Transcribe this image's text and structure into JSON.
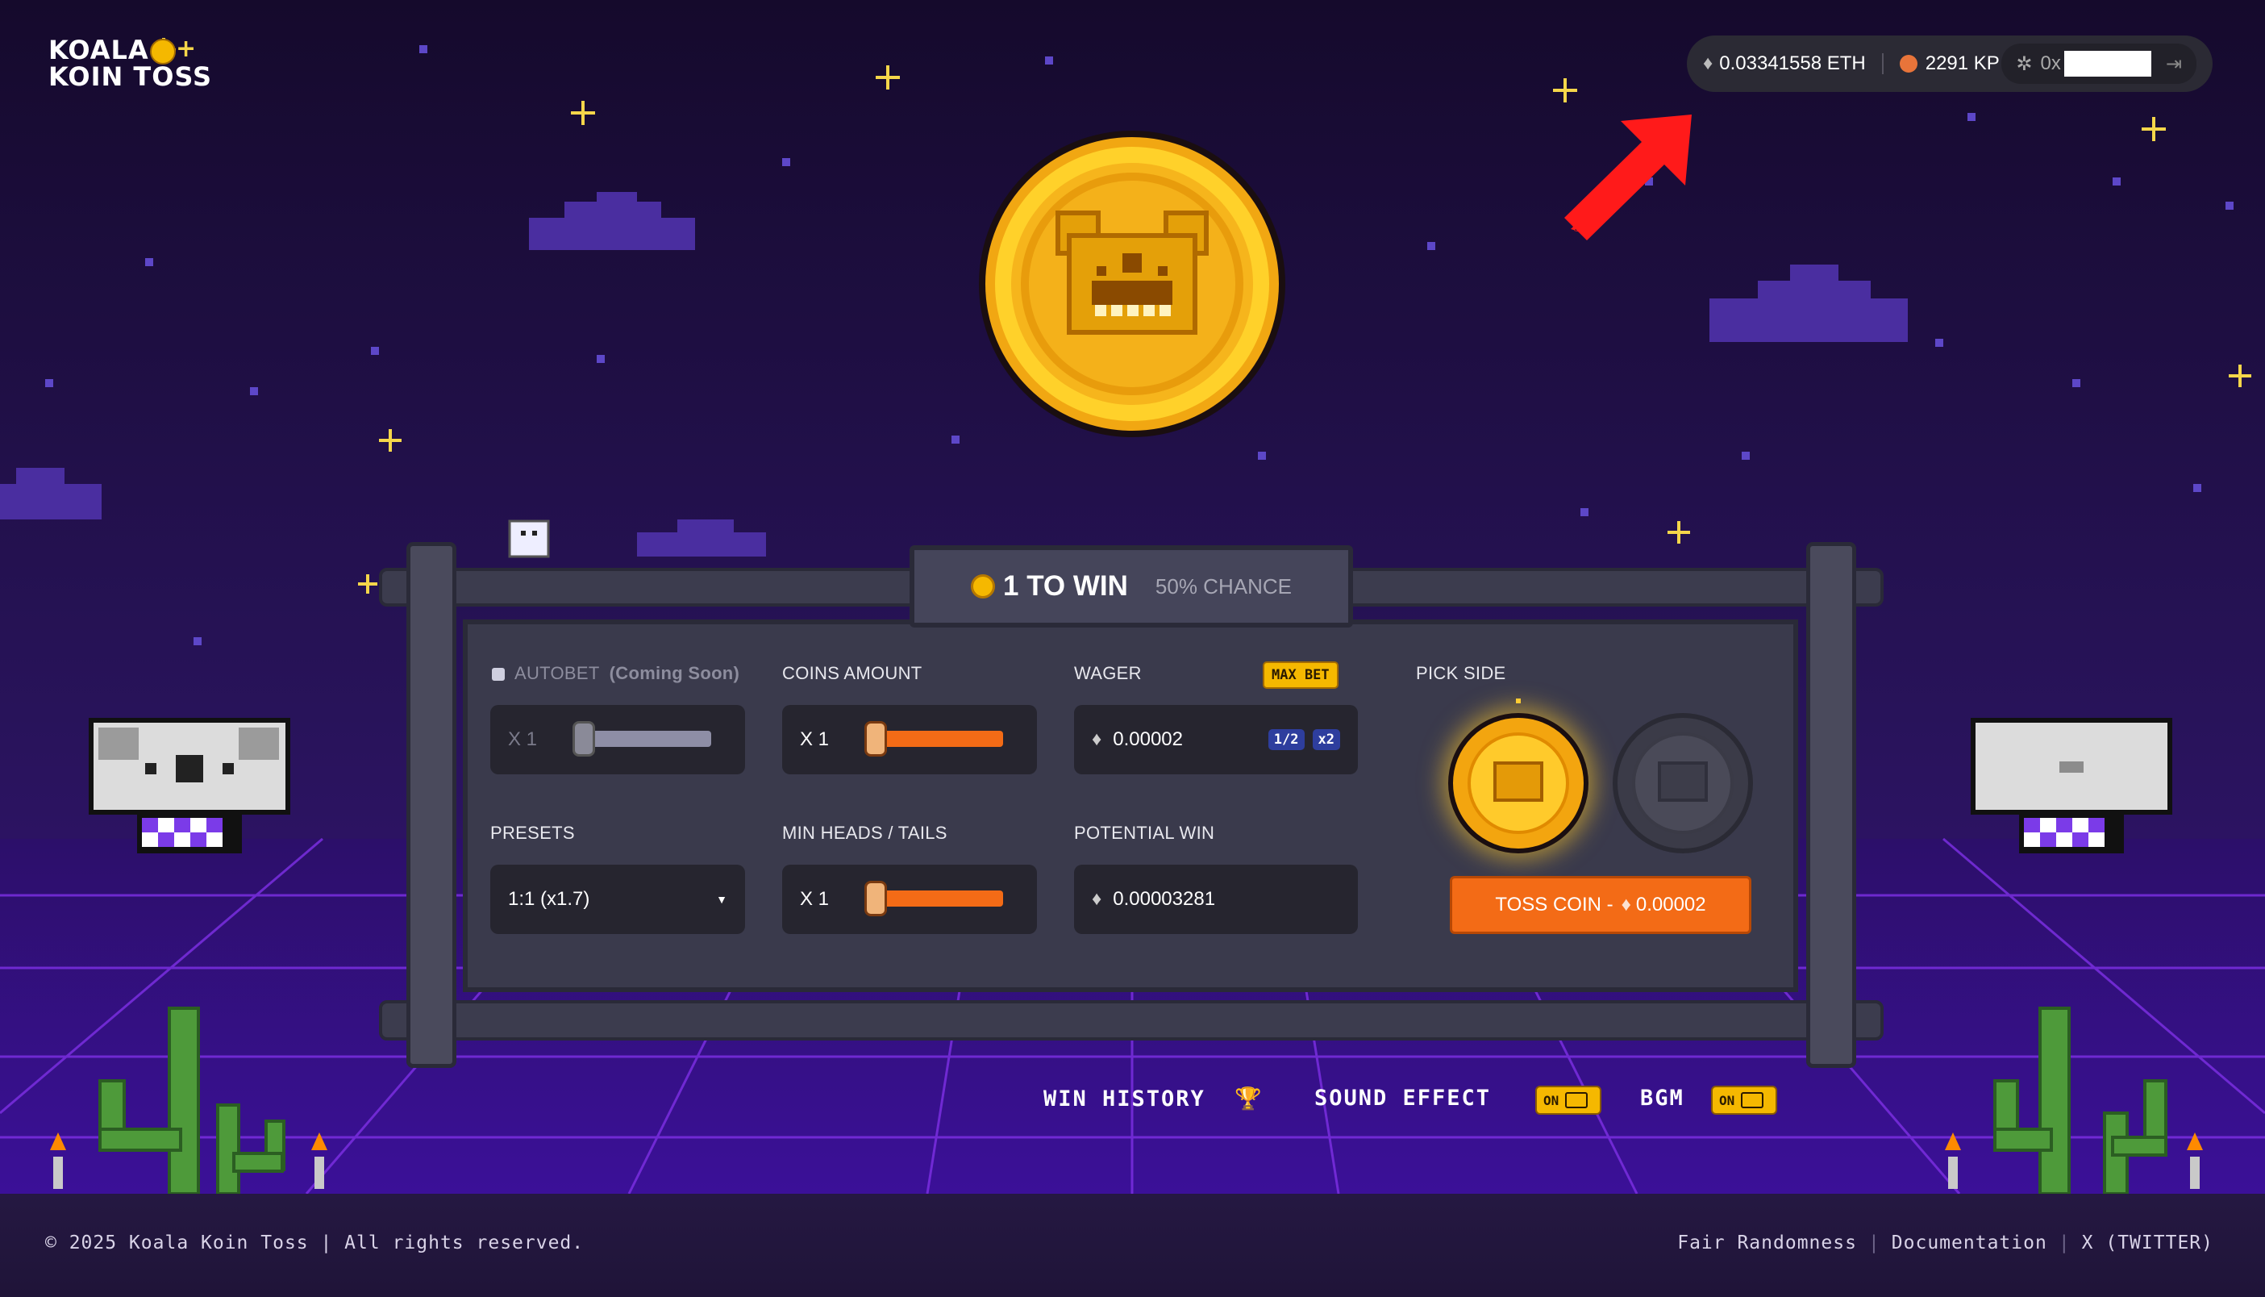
{
  "logo": {
    "line1": "KOALA",
    "line2": "KOIN TOSS"
  },
  "wallet": {
    "eth_balance": "0.03341558 ETH",
    "kp_balance": "2291 KP",
    "address_prefix": "0x"
  },
  "game": {
    "title": "1 TO WIN",
    "subtitle": "50% CHANCE",
    "autobet": {
      "label": "AUTOBET",
      "note": "(Coming Soon)",
      "multiplier": "X 1"
    },
    "coins_amount": {
      "label": "COINS AMOUNT",
      "multiplier": "X 1",
      "level": 0.05
    },
    "wager": {
      "label": "WAGER",
      "max_bet_label": "MAX BET",
      "value": "0.00002",
      "half_label": "1/2",
      "double_label": "x2"
    },
    "pick_side": {
      "label": "PICK SIDE"
    },
    "presets": {
      "label": "PRESETS",
      "selected": "1:1 (x1.7)"
    },
    "min_heads_tails": {
      "label": "MIN HEADS / TAILS",
      "multiplier": "X 1",
      "level": 0.05
    },
    "potential_win": {
      "label": "POTENTIAL WIN",
      "value": "0.00003281"
    },
    "toss_button": {
      "label": "TOSS COIN -",
      "amount": "0.00002"
    }
  },
  "bottom_bar": {
    "win_history": "WIN HISTORY",
    "sound_effect": "SOUND EFFECT",
    "sound_toggle": "ON",
    "bgm": "BGM",
    "bgm_toggle": "ON"
  },
  "footer": {
    "copyright": "© 2025 Koala Koin Toss | All rights reserved.",
    "links": [
      "Fair Randomness",
      "Documentation",
      "X (TWITTER)"
    ]
  },
  "colors": {
    "accent_orange": "#f36b16",
    "gold": "#f5b800",
    "annotation_arrow": "#ff1a1a"
  }
}
